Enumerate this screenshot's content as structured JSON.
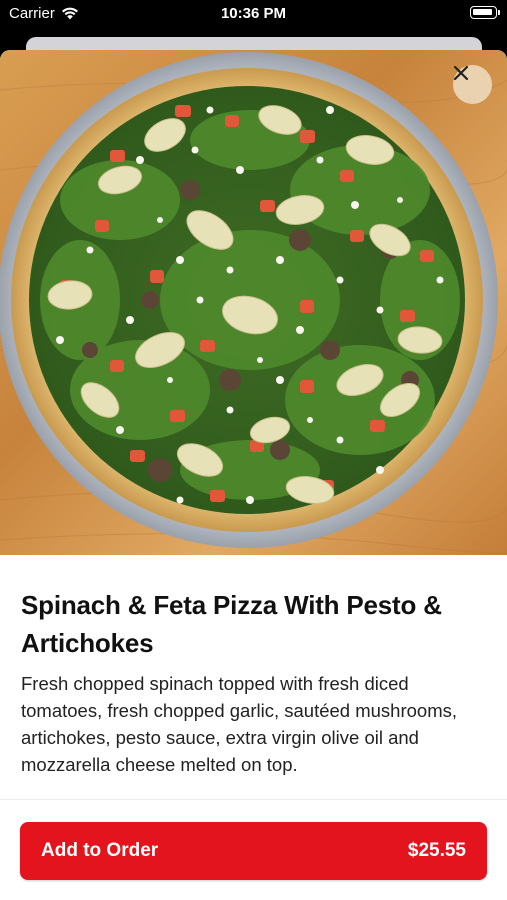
{
  "status_bar": {
    "carrier": "Carrier",
    "time": "10:36 PM"
  },
  "item": {
    "title": "Spinach & Feta Pizza With Pesto & Artichokes",
    "description": "Fresh chopped spinach topped with fresh diced tomatoes, fresh chopped garlic, sautéed mushrooms, artichokes, pesto sauce, extra virgin olive oil and mozzarella cheese melted on top.",
    "image_icon": "pizza-photo"
  },
  "actions": {
    "add_label": "Add to Order",
    "price": "$25.55",
    "close_icon": "close-icon"
  },
  "colors": {
    "accent": "#e3141e",
    "close_bg": "#ecd8ba"
  }
}
